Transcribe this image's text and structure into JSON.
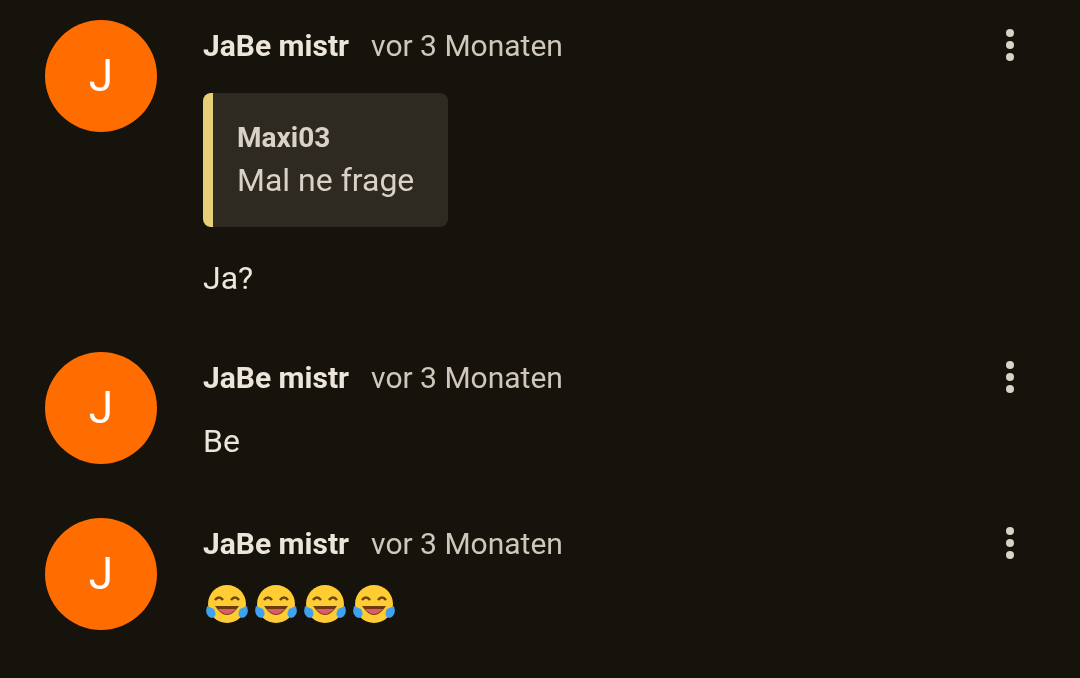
{
  "comments": [
    {
      "avatar_letter": "J",
      "author": "JaBe mistr",
      "time": "vor 3 Monaten",
      "quote": {
        "author": "Maxi03",
        "text": "Mal ne frage"
      },
      "body": [
        {
          "kind": "text",
          "text": "Ja?"
        }
      ]
    },
    {
      "avatar_letter": "J",
      "author": "JaBe mistr",
      "time": "vor 3 Monaten",
      "body": [
        {
          "kind": "text",
          "text": "Be"
        }
      ]
    },
    {
      "avatar_letter": "J",
      "author": "JaBe mistr",
      "time": "vor 3 Monaten",
      "body": [
        {
          "kind": "tears-of-joy"
        },
        {
          "kind": "tears-of-joy"
        },
        {
          "kind": "tears-of-joy"
        },
        {
          "kind": "tears-of-joy"
        }
      ]
    }
  ]
}
